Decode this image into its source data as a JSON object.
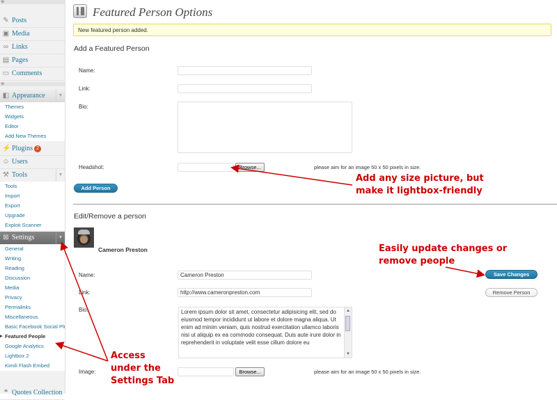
{
  "sidebar": {
    "top_menus": [
      {
        "label": "Posts",
        "icon": "pin-icon"
      },
      {
        "label": "Media",
        "icon": "media-icon"
      },
      {
        "label": "Links",
        "icon": "link-icon"
      },
      {
        "label": "Pages",
        "icon": "pages-icon"
      },
      {
        "label": "Comments",
        "icon": "comments-icon"
      }
    ],
    "appearance": {
      "label": "Appearance",
      "items": [
        "Themes",
        "Widgets",
        "Editor",
        "Add New Themes"
      ]
    },
    "plugins": {
      "label": "Plugins",
      "badge": "2"
    },
    "users": {
      "label": "Users"
    },
    "tools": {
      "label": "Tools",
      "items": [
        "Tools",
        "Import",
        "Export",
        "Upgrade",
        "Exploit Scanner"
      ]
    },
    "settings": {
      "label": "Settings",
      "items": [
        "General",
        "Writing",
        "Reading",
        "Discussion",
        "Media",
        "Privacy",
        "Permalinks",
        "Miscellaneous",
        "Basic Facebook Social Plugins",
        "Featured People",
        "Google Analytics",
        "Lightbox 2",
        "Kimili Flash Embed"
      ]
    },
    "bottom": {
      "label": "Quotes Collection"
    }
  },
  "page": {
    "title": "Featured Person Options",
    "notice": "New featured person added."
  },
  "add_form": {
    "heading": "Add a Featured Person",
    "name_label": "Name:",
    "link_label": "Link:",
    "bio_label": "Bio:",
    "headshot_label": "Headshot:",
    "browse_label": "Browse...",
    "hint": "please aim for an image 50 x 50 pixels in size.",
    "submit_label": "Add Person"
  },
  "edit_section": {
    "heading": "Edit/Remove a person",
    "person_name": "Cameron Preston",
    "name_label": "Name:",
    "name_value": "Cameron Preston",
    "link_label": "Link:",
    "link_value": "http://www.cameronpreston.com",
    "bio_label": "Bio:",
    "bio_value": "Lorem ipsum dolor sit amet, consectetur adipisicing elit, sed do eiusmod tempor incididunt ut labore et dolore magna aliqua. Ut enim ad minim veniam, quis nostrud exercitation ullamco laboris nisi ut aliquip ex ea commodo consequat. Duis aute irure dolor in reprehenderit in voluptate velit esse cillum dolore eu",
    "image_label": "Image:",
    "browse_label": "Browse...",
    "hint": "please aim for an image 50 x 50 pixels in size.",
    "save_label": "Save Changes",
    "remove_label": "Remove Person"
  },
  "annotations": {
    "picture_line1": "Add any size picture, but",
    "picture_line2": "make it lightbox-friendly",
    "update_line1": "Easily update changes or",
    "update_line2": "remove people",
    "access_line1": "Access",
    "access_line2": "under the",
    "access_line3": "Settings Tab"
  },
  "colors": {
    "annotation": "#cc0000",
    "link": "#21759b",
    "notice_bg": "#ffffe0",
    "primary_button": "#21759b"
  }
}
